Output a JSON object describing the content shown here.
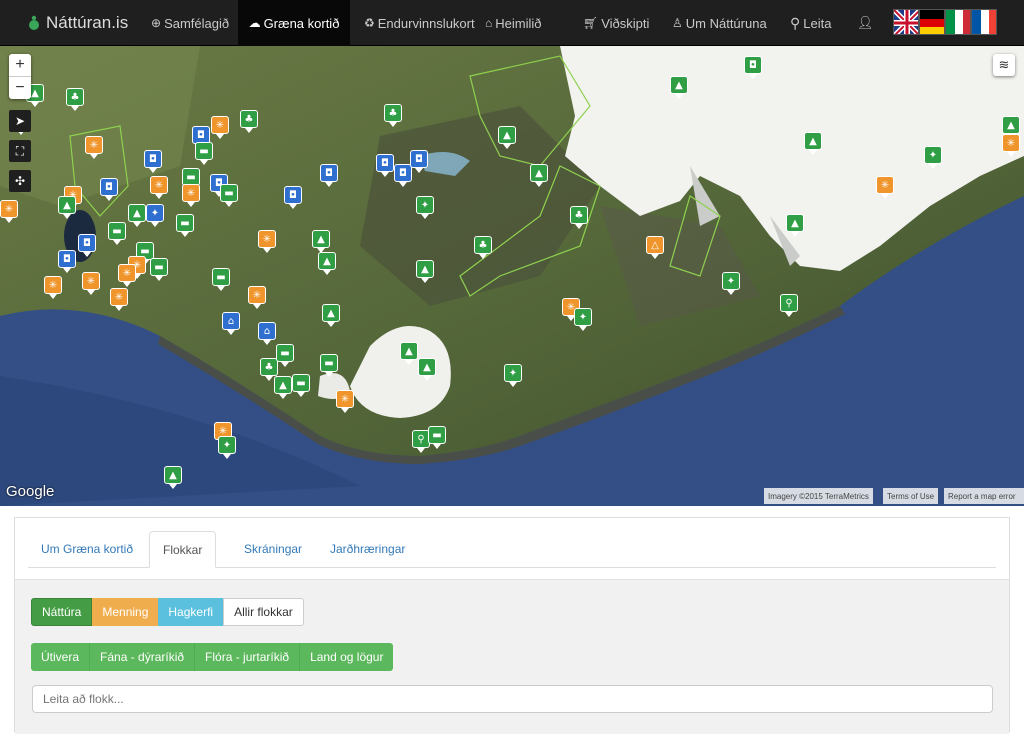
{
  "nav": {
    "brand": "Náttúran.is",
    "items": [
      {
        "label": "Samfélagið",
        "icon": "globe-icon"
      },
      {
        "label": "Græna kortið",
        "icon": "cloud-map-icon",
        "active": true
      },
      {
        "label": "Endurvinnslukort",
        "icon": "recycle-icon"
      },
      {
        "label": "Heimilið",
        "icon": "house-icon"
      },
      {
        "label": "Viðskipti",
        "icon": "cart-icon"
      },
      {
        "label": "Um Náttúruna",
        "icon": "person-icon"
      },
      {
        "label": "Leita",
        "icon": "search-icon"
      }
    ],
    "user_icon": "user-icon",
    "flags": [
      "uk-flag",
      "germany-flag",
      "italy-flag",
      "france-flag"
    ]
  },
  "map": {
    "zoom_in": "+",
    "zoom_out": "−",
    "google_label": "Google",
    "attribution": "Imagery ©2015 TerraMetrics",
    "terms": "Terms of Use",
    "report": "Report a map error",
    "marker_colors": {
      "natura": "#2f9e44",
      "menning": "#f0952b",
      "hagkerfi": "#2f6fd0"
    }
  },
  "panel": {
    "tabs": [
      "Um Græna kortið",
      "Flokkar",
      "Skráningar",
      "Jarðhræringar"
    ],
    "active_tab": "Flokkar",
    "filter_buttons": [
      "Náttúra",
      "Menning",
      "Hagkerfi",
      "Allir flokkar"
    ],
    "sub_buttons": [
      "Útivera",
      "Fána - dýraríkið",
      "Flóra - jurtaríkið",
      "Land og lögur"
    ],
    "search_placeholder": "Leita að flokk..."
  }
}
